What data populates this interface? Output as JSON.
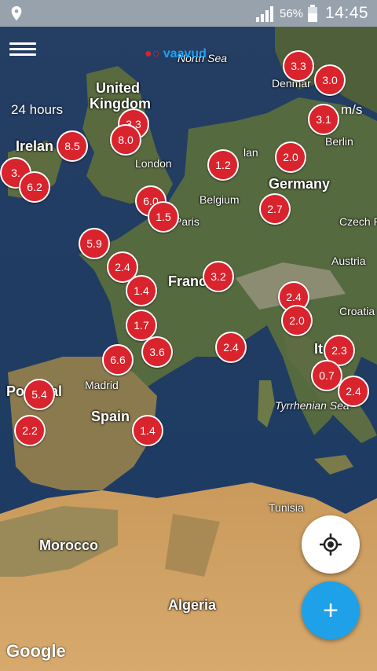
{
  "status_bar": {
    "battery_percent": "56%",
    "time": "14:45",
    "icons": [
      "location-icon",
      "signal-icon",
      "battery-icon"
    ]
  },
  "app": {
    "logo_text": "vaavud",
    "timespan": "24 hours",
    "unit": "m/s",
    "attribution": "Google"
  },
  "map_labels": {
    "north_sea": "North Sea",
    "uk": "United Kingdom",
    "ireland": "Irelan",
    "london": "London",
    "belgium": "Belgium",
    "paris": "Paris",
    "france": "Franc",
    "germany": "Germany",
    "berlin": "Berlin",
    "denmark": "Denmar",
    "czech": "Czech R",
    "austria": "Austria",
    "croatia": "Croatia",
    "italy": "It",
    "tyrrhenian": "Tyrrhenian Sea",
    "portugal": "Po",
    "portugal_end": "al",
    "madrid": "Madrid",
    "spain": "Spain",
    "tunisia": "Tunisia",
    "morocco": "Morocco",
    "algeria": "Algeria",
    "netherlands": "lan"
  },
  "markers": [
    {
      "value": "3.3"
    },
    {
      "value": "3.0"
    },
    {
      "value": "3.1"
    },
    {
      "value": "8.5"
    },
    {
      "value": "3.3"
    },
    {
      "value": "8.0"
    },
    {
      "value": "3."
    },
    {
      "value": "6.2"
    },
    {
      "value": "1.2"
    },
    {
      "value": "2.0"
    },
    {
      "value": "6.0"
    },
    {
      "value": "1.5"
    },
    {
      "value": "2.7"
    },
    {
      "value": "5.9"
    },
    {
      "value": "2.4"
    },
    {
      "value": "1.4"
    },
    {
      "value": "3.2"
    },
    {
      "value": "2.4"
    },
    {
      "value": "2.0"
    },
    {
      "value": "1.7"
    },
    {
      "value": "3.6"
    },
    {
      "value": "6.6"
    },
    {
      "value": "2.4"
    },
    {
      "value": "2.3"
    },
    {
      "value": "0.7"
    },
    {
      "value": "2.4"
    },
    {
      "value": "5.4"
    },
    {
      "value": "2.2"
    },
    {
      "value": "1.4"
    }
  ],
  "buttons": {
    "add": "+"
  }
}
